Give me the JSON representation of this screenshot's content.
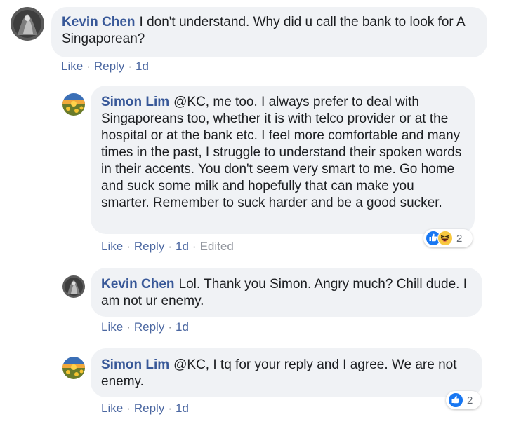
{
  "comments": [
    {
      "author": "Kevin Chen",
      "text": "I don't understand. Why did u call the bank to look for A Singaporean?",
      "actions": {
        "like": "Like",
        "reply": "Reply",
        "time": "1d"
      }
    },
    {
      "author": "Simon Lim",
      "text": "@KC, me too. I always prefer to deal with Singaporeans too, whether it is with telco provider or at the hospital or at the bank etc. I feel more comfortable and many times in the past, I struggle to understand their spoken words in their accents. You don't seem very smart to me. Go home and suck some milk and hopefully that can make you smarter. Remember to suck harder and be a good sucker.",
      "actions": {
        "like": "Like",
        "reply": "Reply",
        "time": "1d",
        "edited": "Edited"
      },
      "reactions": {
        "count": "2",
        "icons": [
          "like-icon",
          "haha-icon"
        ]
      }
    },
    {
      "author": "Kevin Chen",
      "text": "Lol. Thank you Simon. Angry much? Chill dude. I am not ur enemy.",
      "actions": {
        "like": "Like",
        "reply": "Reply",
        "time": "1d"
      }
    },
    {
      "author": "Simon Lim",
      "text": "@KC, I tq for your reply and I agree. We are not enemy.",
      "actions": {
        "like": "Like",
        "reply": "Reply",
        "time": "1d"
      },
      "reactions": {
        "count": "2",
        "icons": [
          "like-icon"
        ]
      }
    }
  ],
  "colors": {
    "author": "#385898",
    "link": "#4b67a1",
    "bubble": "#f0f2f5",
    "like_blue": "#1877f2"
  }
}
